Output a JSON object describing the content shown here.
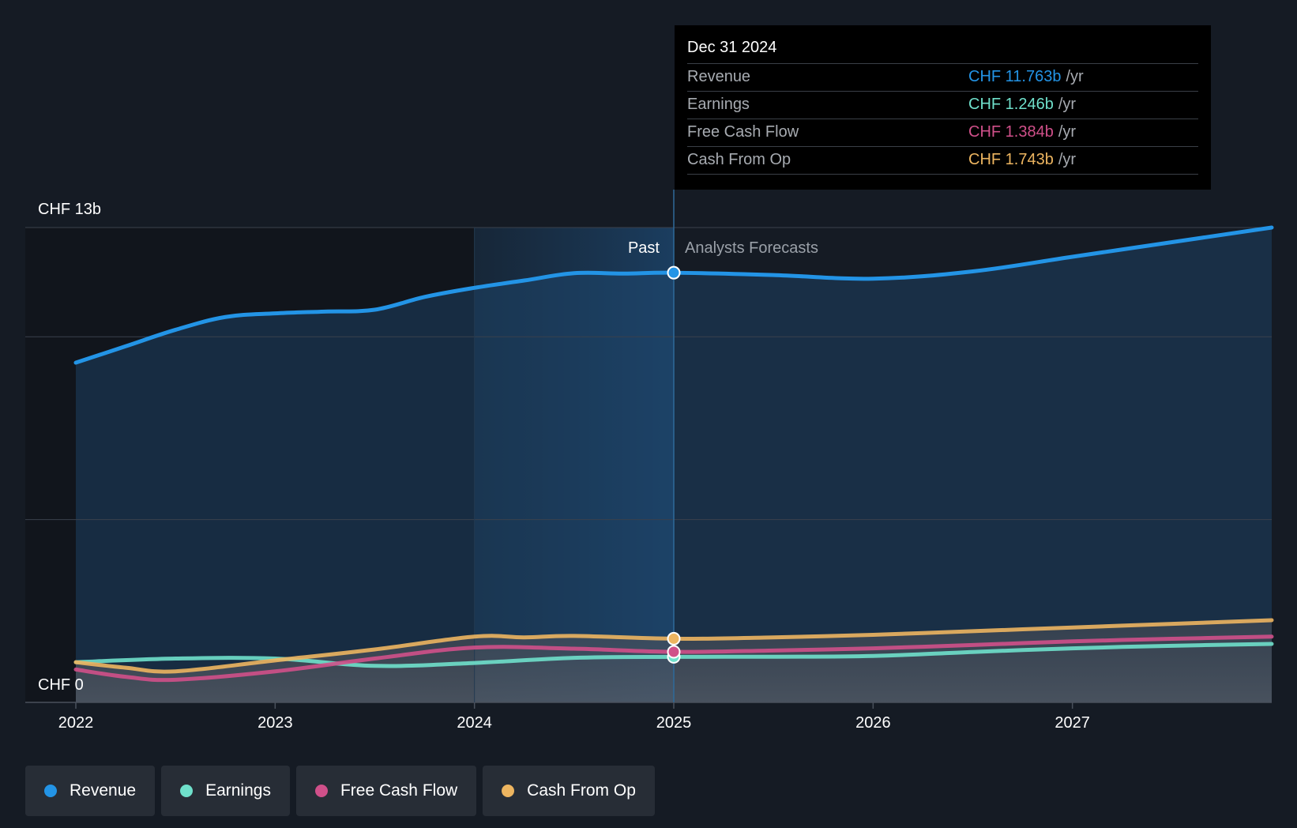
{
  "colors": {
    "revenue": "#2394e6",
    "earnings": "#6fe0cb",
    "free_cash_flow": "#d0508a",
    "cash_from_op": "#edb560"
  },
  "tooltip": {
    "date": "Dec 31 2024",
    "rows": [
      {
        "name": "Revenue",
        "value": "CHF 11.763b",
        "unit": "/yr",
        "color": "#2394e6"
      },
      {
        "name": "Earnings",
        "value": "CHF 1.246b",
        "unit": "/yr",
        "color": "#6fe0cb"
      },
      {
        "name": "Free Cash Flow",
        "value": "CHF 1.384b",
        "unit": "/yr",
        "color": "#d0508a"
      },
      {
        "name": "Cash From Op",
        "value": "CHF 1.743b",
        "unit": "/yr",
        "color": "#edb560"
      }
    ]
  },
  "regions": {
    "past_label": "Past",
    "forecast_label": "Analysts Forecasts"
  },
  "legend": [
    {
      "label": "Revenue",
      "color": "#2394e6"
    },
    {
      "label": "Earnings",
      "color": "#6fe0cb"
    },
    {
      "label": "Free Cash Flow",
      "color": "#d0508a"
    },
    {
      "label": "Cash From Op",
      "color": "#edb560"
    }
  ],
  "chart_data": {
    "type": "line",
    "title": "",
    "xlabel": "",
    "ylabel": "",
    "y_top_label": "CHF 13b",
    "y_bottom_label": "CHF 0",
    "ylim": [
      0,
      13
    ],
    "xlim": [
      2022.0,
      2028.0
    ],
    "x_ticks": [
      "2022",
      "2023",
      "2024",
      "2025",
      "2026",
      "2027"
    ],
    "x_tick_values": [
      2022,
      2023,
      2024,
      2025,
      2026,
      2027
    ],
    "past_highlight_start": 2024.0,
    "past_end": 2025.0,
    "grid": true,
    "legend_position": "bottom",
    "series": [
      {
        "name": "Revenue",
        "color": "#2394e6",
        "x": [
          2022.0,
          2022.25,
          2022.5,
          2022.75,
          2023.0,
          2023.25,
          2023.5,
          2023.75,
          2024.0,
          2024.25,
          2024.5,
          2024.75,
          2025.0,
          2025.5,
          2026.0,
          2026.5,
          2027.0,
          2027.5,
          2028.0
        ],
        "y": [
          9.3,
          9.75,
          10.2,
          10.55,
          10.65,
          10.7,
          10.75,
          11.1,
          11.35,
          11.55,
          11.75,
          11.74,
          11.763,
          11.7,
          11.6,
          11.8,
          12.2,
          12.6,
          13.0
        ]
      },
      {
        "name": "Earnings",
        "color": "#6fe0cb",
        "x": [
          2022.0,
          2022.5,
          2023.0,
          2023.5,
          2024.0,
          2024.5,
          2025.0,
          2025.5,
          2026.0,
          2026.5,
          2027.0,
          2027.5,
          2028.0
        ],
        "y": [
          1.1,
          1.2,
          1.2,
          1.0,
          1.08,
          1.22,
          1.246,
          1.25,
          1.27,
          1.38,
          1.48,
          1.55,
          1.6
        ]
      },
      {
        "name": "Free Cash Flow",
        "color": "#d0508a",
        "x": [
          2022.0,
          2022.25,
          2022.5,
          2023.0,
          2023.5,
          2024.0,
          2024.5,
          2025.0,
          2025.5,
          2026.0,
          2026.5,
          2027.0,
          2027.5,
          2028.0
        ],
        "y": [
          0.9,
          0.7,
          0.62,
          0.85,
          1.2,
          1.5,
          1.47,
          1.384,
          1.42,
          1.48,
          1.57,
          1.67,
          1.74,
          1.8
        ]
      },
      {
        "name": "Cash From Op",
        "color": "#edb560",
        "x": [
          2022.0,
          2022.25,
          2022.5,
          2023.0,
          2023.5,
          2024.0,
          2024.25,
          2024.5,
          2025.0,
          2025.5,
          2026.0,
          2026.5,
          2027.0,
          2027.5,
          2028.0
        ],
        "y": [
          1.1,
          0.95,
          0.85,
          1.15,
          1.45,
          1.8,
          1.78,
          1.82,
          1.743,
          1.78,
          1.85,
          1.95,
          2.05,
          2.15,
          2.25
        ]
      }
    ]
  }
}
